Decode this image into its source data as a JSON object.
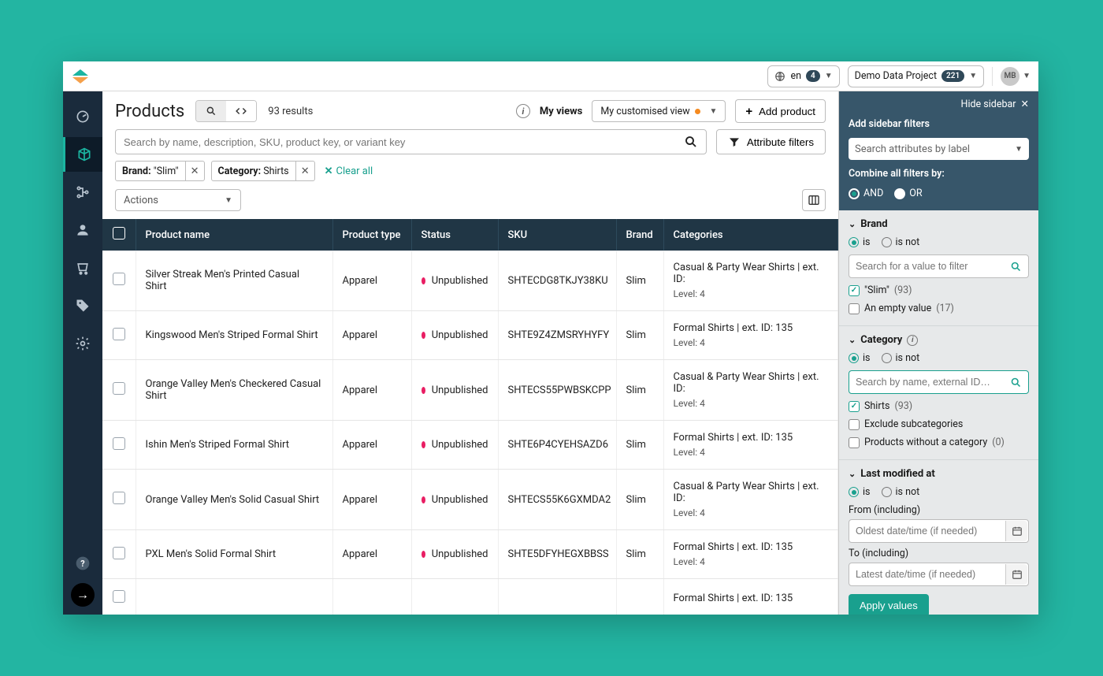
{
  "topbar": {
    "lang": "en",
    "lang_badge": "4",
    "project": "Demo Data Project",
    "project_badge": "221",
    "avatar": "MB"
  },
  "page": {
    "title": "Products",
    "results": "93 results",
    "myviews_label": "My views",
    "view_name": "My customised view",
    "add_button": "Add product",
    "search_placeholder": "Search by name, description, SKU, product key, or variant key",
    "attr_filter_btn": "Attribute filters",
    "actions_label": "Actions",
    "clear_all": "Clear all"
  },
  "chips": [
    {
      "label": "Brand:",
      "value": " \"Slim\""
    },
    {
      "label": "Category:",
      "value": " Shirts"
    }
  ],
  "columns": [
    "Product name",
    "Product type",
    "Status",
    "SKU",
    "Brand",
    "Categories"
  ],
  "rows": [
    {
      "name": "Silver Streak Men's Printed Casual Shirt",
      "type": "Apparel",
      "status": "Unpublished",
      "sku": "SHTECDG8TKJY38KU",
      "brand": "Slim",
      "cat1": "Casual & Party Wear Shirts | ext. ID:",
      "cat2": "Level: 4"
    },
    {
      "name": "Kingswood Men's Striped Formal Shirt",
      "type": "Apparel",
      "status": "Unpublished",
      "sku": "SHTE9Z4ZMSRYHYFY",
      "brand": "Slim",
      "cat1": "Formal Shirts | ext. ID: 135",
      "cat2": "Level: 4"
    },
    {
      "name": "Orange Valley Men's Checkered Casual Shirt",
      "type": "Apparel",
      "status": "Unpublished",
      "sku": "SHTECS55PWBSKCPP",
      "brand": "Slim",
      "cat1": "Casual & Party Wear Shirts | ext. ID:",
      "cat2": "Level: 4"
    },
    {
      "name": "Ishin Men's Striped Formal Shirt",
      "type": "Apparel",
      "status": "Unpublished",
      "sku": "SHTE6P4CYEHSAZD6",
      "brand": "Slim",
      "cat1": "Formal Shirts | ext. ID: 135",
      "cat2": "Level: 4"
    },
    {
      "name": "Orange Valley Men's Solid Casual Shirt",
      "type": "Apparel",
      "status": "Unpublished",
      "sku": "SHTECS55K6GXMDA2",
      "brand": "Slim",
      "cat1": "Casual & Party Wear Shirts | ext. ID:",
      "cat2": "Level: 4"
    },
    {
      "name": "PXL Men's Solid Formal Shirt",
      "type": "Apparel",
      "status": "Unpublished",
      "sku": "SHTE5DFYHEGXBBSS",
      "brand": "Slim",
      "cat1": "Formal Shirts | ext. ID: 135",
      "cat2": "Level: 4"
    },
    {
      "name": "",
      "type": "",
      "status": "",
      "sku": "",
      "brand": "",
      "cat1": "Formal Shirts | ext. ID: 135",
      "cat2": ""
    }
  ],
  "sidebar": {
    "hide": "Hide sidebar",
    "add_filters_label": "Add sidebar filters",
    "attr_search_placeholder": "Search attributes by label",
    "combine_label": "Combine all filters by:",
    "and": "AND",
    "or": "OR",
    "brand": {
      "title": "Brand",
      "is": "is",
      "isnot": "is not",
      "search_placeholder": "Search for a value to filter",
      "opt1": "\"Slim\"",
      "opt1_count": "(93)",
      "opt2": "An empty value",
      "opt2_count": "(17)"
    },
    "category": {
      "title": "Category",
      "is": "is",
      "isnot": "is not",
      "search_placeholder": "Search by name, external ID…",
      "opt1": "Shirts",
      "opt1_count": "(93)",
      "opt2": "Exclude subcategories",
      "opt3": "Products without a category",
      "opt3_count": "(0)"
    },
    "modified": {
      "title": "Last modified at",
      "is": "is",
      "isnot": "is not",
      "from_label": "From (including)",
      "from_placeholder": "Oldest date/time (if needed)",
      "to_label": "To (including)",
      "to_placeholder": "Latest date/time (if needed)",
      "apply": "Apply values"
    }
  }
}
